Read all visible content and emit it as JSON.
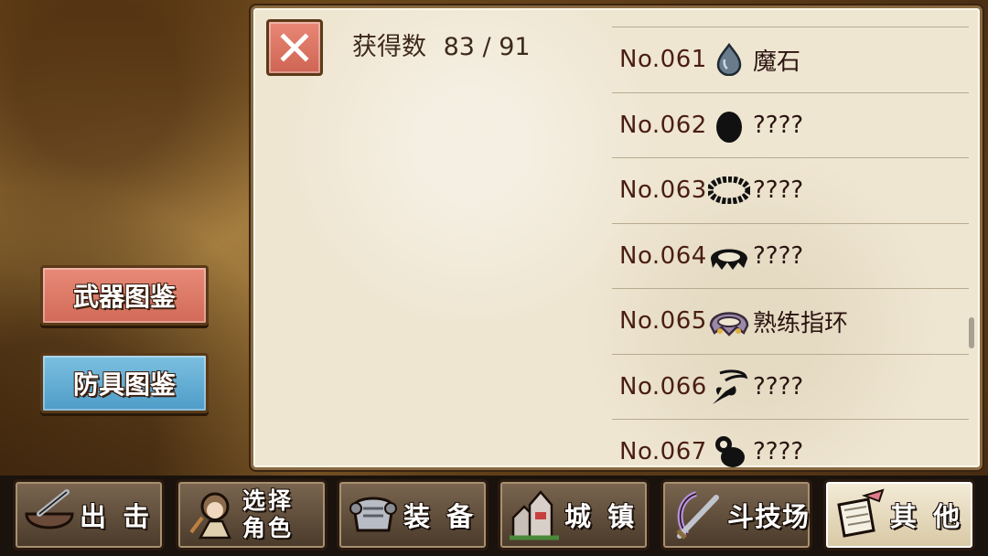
{
  "side_buttons": {
    "weapon_catalog": "武器图鉴",
    "armor_catalog": "防具图鉴"
  },
  "panel": {
    "count_label": "获得数",
    "count_value": "83 / 91",
    "items": [
      {
        "num": "No.061",
        "name": "魔石",
        "icon": "magic-stone-icon"
      },
      {
        "num": "No.062",
        "name": "????",
        "icon": "unknown-drop-icon"
      },
      {
        "num": "No.063",
        "name": "????",
        "icon": "unknown-ring-icon"
      },
      {
        "num": "No.064",
        "name": "????",
        "icon": "unknown-crown-icon"
      },
      {
        "num": "No.065",
        "name": "熟练指环",
        "icon": "skilled-ring-icon"
      },
      {
        "num": "No.066",
        "name": "????",
        "icon": "unknown-feather-icon"
      },
      {
        "num": "No.067",
        "name": "????",
        "icon": "unknown-pouch-icon"
      }
    ]
  },
  "bottom_nav": {
    "sortie": "出 击",
    "select_char_line1": "选择",
    "select_char_line2": "角色",
    "equipment": "装 备",
    "town": "城 镇",
    "arena": "斗技场",
    "other": "其 他"
  },
  "colors": {
    "weapon_btn": "#d26a58",
    "armor_btn": "#4e9cc8",
    "panel_bg": "#efe6d2",
    "item_text": "#4a1e12"
  }
}
